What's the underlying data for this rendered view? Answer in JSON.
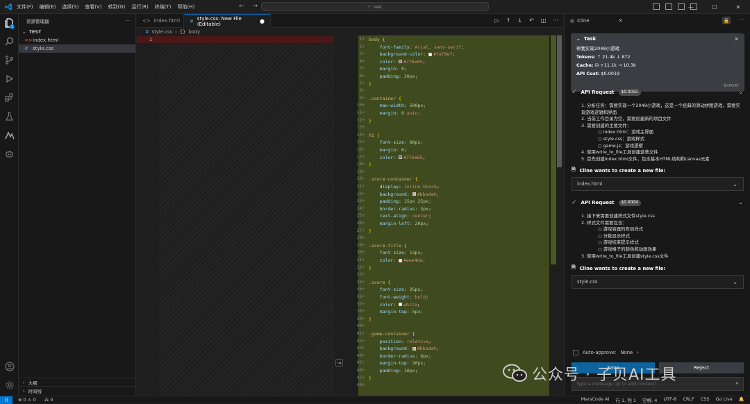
{
  "titlebar": {
    "menu": [
      "文件(F)",
      "编辑(E)",
      "选择(S)",
      "查看(V)",
      "转到(G)",
      "运行(R)",
      "终端(T)",
      "帮助(H)"
    ],
    "search": "test"
  },
  "sidebar": {
    "title": "资源管理器",
    "folder": "TEST",
    "files": [
      {
        "name": "index.html",
        "icon": "html-icon"
      },
      {
        "name": "style.css",
        "icon": "css-icon",
        "selected": true
      }
    ],
    "outline": "大纲",
    "timeline": "时间线"
  },
  "tabs": [
    {
      "label": "index.html",
      "active": false
    },
    {
      "label": "style.css: New File (Editable)",
      "active": true
    }
  ],
  "breadcrumb": {
    "file": "style.css",
    "symbol": "body"
  },
  "left_editor": {
    "line_number": "1"
  },
  "code_lines": [
    [
      [
        "sel-c",
        "body "
      ],
      [
        "brace",
        "{"
      ]
    ],
    [
      [
        "prop",
        "    font-family"
      ],
      [
        "pun",
        ": "
      ],
      [
        "val",
        "Arial, sans-serif"
      ],
      [
        "pun",
        ";"
      ]
    ],
    [
      [
        "prop",
        "    background-color"
      ],
      [
        "pun",
        ": "
      ],
      [
        "sw",
        "#faf8ef"
      ],
      [
        "val",
        "#faf8ef"
      ],
      [
        "pun",
        ";"
      ]
    ],
    [
      [
        "prop",
        "    color"
      ],
      [
        "pun",
        ": "
      ],
      [
        "sw",
        "#776e65"
      ],
      [
        "val",
        "#776e65"
      ],
      [
        "pun",
        ";"
      ]
    ],
    [
      [
        "prop",
        "    margin"
      ],
      [
        "pun",
        ": "
      ],
      [
        "num",
        "0"
      ],
      [
        "pun",
        ";"
      ]
    ],
    [
      [
        "prop",
        "    padding"
      ],
      [
        "pun",
        ": "
      ],
      [
        "num",
        "20px"
      ],
      [
        "pun",
        ";"
      ]
    ],
    [
      [
        "brace",
        "}"
      ]
    ],
    [],
    [
      [
        "sel-c",
        ".container "
      ],
      [
        "brace",
        "{"
      ]
    ],
    [
      [
        "prop",
        "    max-width"
      ],
      [
        "pun",
        ": "
      ],
      [
        "num",
        "500px"
      ],
      [
        "pun",
        ";"
      ]
    ],
    [
      [
        "prop",
        "    margin"
      ],
      [
        "pun",
        ": "
      ],
      [
        "num",
        "0"
      ],
      [
        "val",
        " auto"
      ],
      [
        "pun",
        ";"
      ]
    ],
    [
      [
        "brace",
        "}"
      ]
    ],
    [],
    [
      [
        "sel-c",
        "h1 "
      ],
      [
        "brace",
        "{"
      ]
    ],
    [
      [
        "prop",
        "    font-size"
      ],
      [
        "pun",
        ": "
      ],
      [
        "num",
        "80px"
      ],
      [
        "pun",
        ";"
      ]
    ],
    [
      [
        "prop",
        "    margin"
      ],
      [
        "pun",
        ": "
      ],
      [
        "num",
        "0"
      ],
      [
        "pun",
        ";"
      ]
    ],
    [
      [
        "prop",
        "    color"
      ],
      [
        "pun",
        ": "
      ],
      [
        "sw",
        "#776e65"
      ],
      [
        "val",
        "#776e65"
      ],
      [
        "pun",
        ";"
      ]
    ],
    [
      [
        "brace",
        "}"
      ]
    ],
    [],
    [
      [
        "sel-c",
        ".score-container "
      ],
      [
        "brace",
        "{"
      ]
    ],
    [
      [
        "prop",
        "    display"
      ],
      [
        "pun",
        ": "
      ],
      [
        "val",
        "inline-block"
      ],
      [
        "pun",
        ";"
      ]
    ],
    [
      [
        "prop",
        "    background"
      ],
      [
        "pun",
        ": "
      ],
      [
        "sw",
        "#bbada0"
      ],
      [
        "val",
        "#bbada0"
      ],
      [
        "pun",
        ";"
      ]
    ],
    [
      [
        "prop",
        "    padding"
      ],
      [
        "pun",
        ": "
      ],
      [
        "num",
        "15px 25px"
      ],
      [
        "pun",
        ";"
      ]
    ],
    [
      [
        "prop",
        "    border-radius"
      ],
      [
        "pun",
        ": "
      ],
      [
        "num",
        "3px"
      ],
      [
        "pun",
        ";"
      ]
    ],
    [
      [
        "prop",
        "    text-align"
      ],
      [
        "pun",
        ": "
      ],
      [
        "val",
        "center"
      ],
      [
        "pun",
        ";"
      ]
    ],
    [
      [
        "prop",
        "    margin-left"
      ],
      [
        "pun",
        ": "
      ],
      [
        "num",
        "20px"
      ],
      [
        "pun",
        ";"
      ]
    ],
    [
      [
        "brace",
        "}"
      ]
    ],
    [],
    [
      [
        "sel-c",
        ".score-title "
      ],
      [
        "brace",
        "{"
      ]
    ],
    [
      [
        "prop",
        "    font-size"
      ],
      [
        "pun",
        ": "
      ],
      [
        "num",
        "13px"
      ],
      [
        "pun",
        ";"
      ]
    ],
    [
      [
        "prop",
        "    color"
      ],
      [
        "pun",
        ": "
      ],
      [
        "sw",
        "#eee4da"
      ],
      [
        "val",
        "#eee4da"
      ],
      [
        "pun",
        ";"
      ]
    ],
    [
      [
        "brace",
        "}"
      ]
    ],
    [],
    [
      [
        "sel-c",
        ".score "
      ],
      [
        "brace",
        "{"
      ]
    ],
    [
      [
        "prop",
        "    font-size"
      ],
      [
        "pun",
        ": "
      ],
      [
        "num",
        "25px"
      ],
      [
        "pun",
        ";"
      ]
    ],
    [
      [
        "prop",
        "    font-weight"
      ],
      [
        "pun",
        ": "
      ],
      [
        "val",
        "bold"
      ],
      [
        "pun",
        ";"
      ]
    ],
    [
      [
        "prop",
        "    color"
      ],
      [
        "pun",
        ": "
      ],
      [
        "sw",
        "#ffffff"
      ],
      [
        "val",
        "white"
      ],
      [
        "pun",
        ";"
      ]
    ],
    [
      [
        "prop",
        "    margin-top"
      ],
      [
        "pun",
        ": "
      ],
      [
        "num",
        "5px"
      ],
      [
        "pun",
        ";"
      ]
    ],
    [
      [
        "brace",
        "}"
      ]
    ],
    [],
    [
      [
        "sel-c",
        ".game-container "
      ],
      [
        "brace",
        "{"
      ]
    ],
    [
      [
        "prop",
        "    position"
      ],
      [
        "pun",
        ": "
      ],
      [
        "val",
        "relative"
      ],
      [
        "pun",
        ";"
      ]
    ],
    [
      [
        "prop",
        "    background"
      ],
      [
        "pun",
        ": "
      ],
      [
        "sw",
        "#bbada0"
      ],
      [
        "val",
        "#bbada0"
      ],
      [
        "pun",
        ";"
      ]
    ],
    [
      [
        "prop",
        "    border-radius"
      ],
      [
        "pun",
        ": "
      ],
      [
        "num",
        "6px"
      ],
      [
        "pun",
        ";"
      ]
    ],
    [
      [
        "prop",
        "    margin-top"
      ],
      [
        "pun",
        ": "
      ],
      [
        "num",
        "20px"
      ],
      [
        "pun",
        ";"
      ]
    ],
    [
      [
        "prop",
        "    padding"
      ],
      [
        "pun",
        ": "
      ],
      [
        "num",
        "10px"
      ],
      [
        "pun",
        ";"
      ]
    ],
    [
      [
        "brace",
        "}"
      ]
    ],
    []
  ],
  "cline": {
    "tab": "Cline",
    "task": {
      "heading": "Task",
      "text": "帮我实现2048小游戏",
      "tokens_label": "Tokens:",
      "tokens": "↑ 21.4k  ↓ 872",
      "cache_label": "Cache:",
      "cache": "+11.1k  → 10.3k",
      "cost_label": "API Cost:",
      "cost": "$0.0019",
      "export": "EXPORT"
    },
    "req1": {
      "label": "API Request",
      "cost": "$0.0015"
    },
    "list1": [
      {
        "t": "1. 分析任务：需要实现一个2048小游戏，这是一个经典的滑动拼图游戏，需要实现游戏逻辑和界面",
        "sub": false
      },
      {
        "t": "2. 当前工作目录为空，需要创建新的项目文件",
        "sub": false
      },
      {
        "t": "3. 需要创建的主要文件：",
        "sub": false
      },
      {
        "t": "○   index.html：游戏主界面",
        "sub": true
      },
      {
        "t": "○   style.css：游戏样式",
        "sub": true
      },
      {
        "t": "○   game.js：游戏逻辑",
        "sub": true
      },
      {
        "t": "4. 使用write_to_file工具创建这些文件",
        "sub": false
      },
      {
        "t": "5. 首先创建index.html文件，包含基本HTML结构和canvas元素",
        "sub": false
      }
    ],
    "want1": "Cline wants to create a new file:",
    "file1": "index.html",
    "req2": {
      "label": "API Request",
      "cost": "$0.0004"
    },
    "list2": [
      {
        "t": "1. 接下来需要创建样式文件style.css",
        "sub": false
      },
      {
        "t": "2. 样式文件需要包含：",
        "sub": false
      },
      {
        "t": "○   游戏容器的布局样式",
        "sub": true
      },
      {
        "t": "○   分数显示样式",
        "sub": true
      },
      {
        "t": "○   游戏结束提示样式",
        "sub": true
      },
      {
        "t": "○   游戏格子的颜色和动画效果",
        "sub": true
      },
      {
        "t": "3. 使用write_to_file工具创建style.css文件",
        "sub": false
      }
    ],
    "want2": "Cline wants to create a new file:",
    "file2": "style.css",
    "auto_approve": "Auto-approve:",
    "auto_approve_value": "None",
    "save": "Save",
    "reject": "Reject",
    "input_placeholder": "Type a message (@ to add context)..."
  },
  "watermark": "公众号 · 子贝AI工具",
  "status": {
    "problems": "⊗ 0 ⚠ 0",
    "ports": "⁂ 0",
    "right": [
      "MarsCode AI",
      "行 1, 列 1",
      "空格: 4",
      "UTF-8",
      "CRLF",
      "CSS",
      "Go Live"
    ]
  },
  "colors": {
    "accent": "#0078d4",
    "diff_added": "#3f4a1e",
    "diff_removed": "#4b1818"
  }
}
